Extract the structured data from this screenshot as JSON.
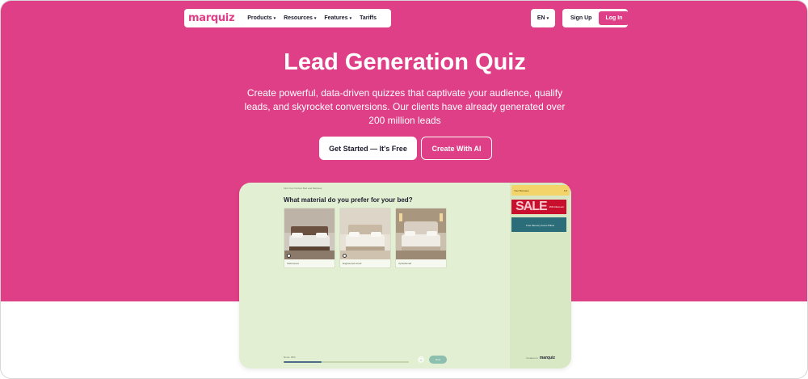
{
  "colors": {
    "accent": "#df3f86",
    "quiz_bg": "#e3efd3",
    "sidebar_bg": "#d9e8c4",
    "progress": "#4f6b8a"
  },
  "nav": {
    "logo": "marquiz",
    "items": [
      {
        "label": "Products",
        "has_dropdown": true
      },
      {
        "label": "Resources",
        "has_dropdown": true
      },
      {
        "label": "Features",
        "has_dropdown": true
      },
      {
        "label": "Tariffs",
        "has_dropdown": false
      }
    ],
    "language": "EN",
    "sign_up": "Sign Up",
    "log_in": "Log In",
    "chevron": "▾"
  },
  "hero": {
    "title": "Lead Generation Quiz",
    "subtitle": "Create powerful, data-driven quizzes that captivate your audience, qualify leads, and skyrocket conversions. Our clients have already generated over 200 million leads",
    "cta_primary": "Get Started — It's Free",
    "cta_secondary": "Create With AI"
  },
  "quiz": {
    "breadcrumb": "Find Your Perfect Bed and Mattress",
    "question": "What material do you prefer for your bed?",
    "options": [
      {
        "label": "Solid wood",
        "icon": "bed-photo"
      },
      {
        "label": "Engineered wood",
        "icon": "bed-photo"
      },
      {
        "label": "Upholstered",
        "icon": "bed-photo"
      }
    ],
    "progress_label": "Done: 30%",
    "progress_value": 0.3,
    "back": "‹",
    "next": "Next",
    "sidebar": {
      "bonus_title": "Your Bonuses",
      "bonus_count": "1/3",
      "sale_text": "SALE",
      "sale_caption": "15% Discount",
      "memory_caption": "Free Memory Foam Pillow"
    },
    "powered_by": "Created on",
    "powered_brand": "marquiz"
  }
}
